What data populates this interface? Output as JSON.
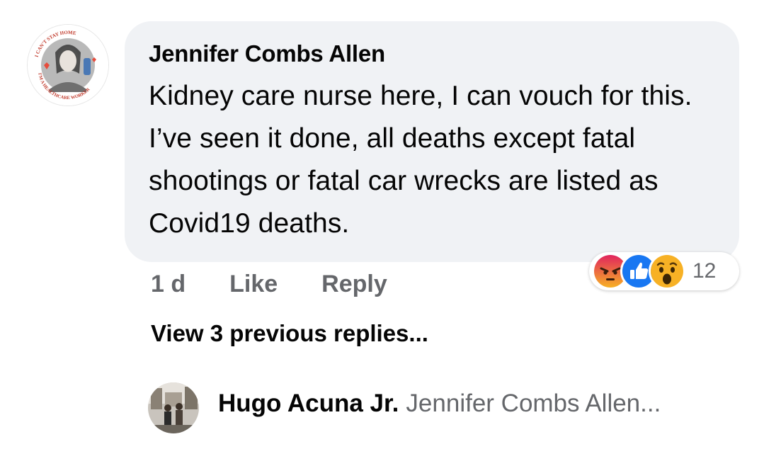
{
  "comment": {
    "author": "Jennifer Combs Allen",
    "text": "Kidney care nurse here, I can vouch for this. I’ve seen it done, all deaths except fatal shootings or fatal car wrecks are listed as Covid19 deaths.",
    "avatar_badge_top": "I CAN'T STAY HOME",
    "avatar_badge_bottom": "I'M A HEALTHCARE WORKER",
    "time": "1 d",
    "like_label": "Like",
    "reply_label": "Reply",
    "reactions": {
      "icons": [
        "angry-icon",
        "like-icon",
        "wow-icon"
      ],
      "count": "12"
    }
  },
  "view_previous_replies": "View 3 previous replies...",
  "latest_reply": {
    "author": "Hugo Acuna Jr.",
    "preview": "Jennifer Combs Allen..."
  },
  "colors": {
    "bubble_bg": "#f0f2f5",
    "secondary_text": "#65676b",
    "like_blue": "#1877f2",
    "angry_orange": "#e9710f",
    "wow_yellow": "#f7b125"
  }
}
